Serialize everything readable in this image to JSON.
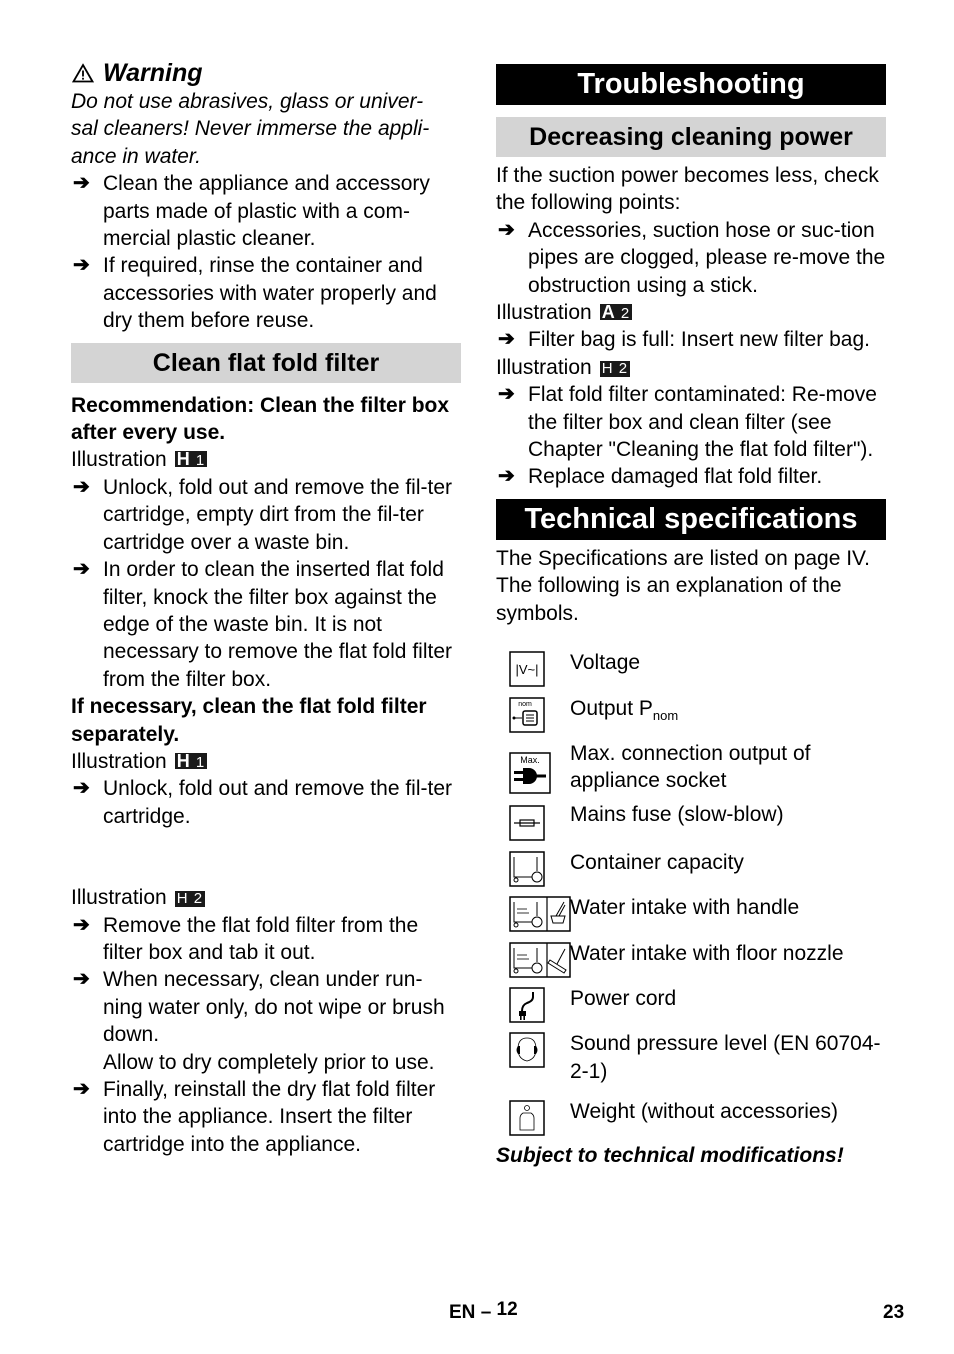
{
  "left": {
    "warning": {
      "title": "Warning",
      "text": "Do not use abrasives, glass or univer-sal cleaners! Never immerse the appli-ance in water.",
      "lines": [
        "Do not use abrasives, glass or univer-",
        "sal cleaners! Never immerse the appli-",
        "ance in water."
      ],
      "steps": [
        "Clean the appliance and accessory parts made of plastic with a com-mercial plastic cleaner.",
        "If required, rinse the container and accessories with water properly and dry them before reuse."
      ]
    },
    "clean_filter": {
      "heading": "Clean flat fold filter",
      "recommendation": "Recommendation: Clean the filter box after every use.",
      "illustration_label": "Illustration",
      "illustration_1": {
        "letter": "H",
        "num": "1"
      },
      "steps_1": [
        "Unlock, fold out and remove the fil-ter cartridge, empty dirt from the fil-ter cartridge over a waste bin.",
        "In order to clean the inserted flat fold filter, knock the filter box against the edge of the waste bin. It is not necessary to remove the flat fold filter from the filter box."
      ],
      "separately_note": "If necessary, clean the flat fold filter separately.",
      "illustration_2": {
        "letter": "H",
        "num": "1"
      },
      "steps_2": [
        "Unlock, fold out and remove the fil-ter cartridge."
      ],
      "illustration_3": {
        "letter": "H",
        "num": "2"
      },
      "steps_3": [
        "Remove the flat fold filter from the filter box and tab it out.",
        "When necessary, clean under run-ning water only, do not wipe or brush down."
      ],
      "dry_note": "Allow to dry completely prior to use.",
      "steps_4": [
        "Finally, reinstall the dry flat fold filter into the appliance. Insert the filter cartridge into the appliance."
      ]
    }
  },
  "right": {
    "troubleshooting": {
      "heading": "Troubleshooting",
      "subheading": "Decreasing cleaning power",
      "intro": "If the suction power becomes less, check the following points:",
      "step_1": "Accessories, suction hose or suc-tion pipes are clogged, please re-move the obstruction using a stick.",
      "illustration_label": "Illustration",
      "illustration_a": {
        "letter": "A",
        "num": "2"
      },
      "step_2": "Filter bag is full: Insert new filter bag.",
      "illustration_b": {
        "letter": "H",
        "num": "2"
      },
      "step_3": "Flat fold filter contaminated: Re-move the filter box and clean filter (see Chapter \"Cleaning the flat fold filter\").",
      "step_4": "Replace damaged flat fold filter."
    },
    "tech_specs": {
      "heading": "Technical specifications",
      "intro": "The Specifications are listed on page IV. The following is an explanation of the symbols.",
      "symbols": [
        {
          "icon": "voltage-icon",
          "glyph": "|V~|",
          "label": "Voltage"
        },
        {
          "icon": "output-power-icon",
          "glyph": "nom",
          "label": "Output P",
          "sub": "nom"
        },
        {
          "icon": "max-connection-plug-icon",
          "glyph": "Max.",
          "label": "Max. connection output of appliance socket"
        },
        {
          "icon": "fuse-icon",
          "label": "Mains fuse (slow-blow)"
        },
        {
          "icon": "container-icon",
          "label": "Container capacity"
        },
        {
          "icon": "water-intake-handle-icon",
          "label": "Water intake with handle"
        },
        {
          "icon": "water-intake-floor-nozzle-icon",
          "label": "Water intake with floor nozzle"
        },
        {
          "icon": "power-cord-icon",
          "label": "Power cord"
        },
        {
          "icon": "sound-pressure-icon",
          "label": "Sound pressure level (EN 60704-2-1)"
        },
        {
          "icon": "weight-icon",
          "label": "Weight (without accessories)"
        }
      ],
      "footnote": "Subject to technical modifications!"
    }
  },
  "footer": {
    "lang_page": "EN",
    "dash": "–",
    "section_page": "12",
    "page_number": "23"
  }
}
